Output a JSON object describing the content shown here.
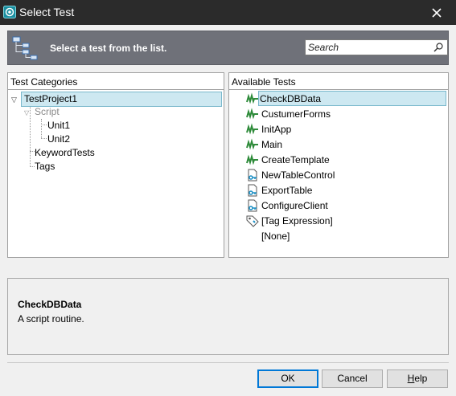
{
  "window": {
    "title": "Select Test",
    "close_icon": "close-icon",
    "app_icon": "app-icon"
  },
  "header": {
    "text": "Select a test from the list.",
    "icon": "tree-icon"
  },
  "search": {
    "placeholder": "Search",
    "icon": "search-icon"
  },
  "categories": {
    "heading": "Test Categories",
    "tree": {
      "project": "TestProject1",
      "script": "Script",
      "unit1": "Unit1",
      "unit2": "Unit2",
      "keyword_tests": "KeywordTests",
      "tags": "Tags"
    }
  },
  "tests": {
    "heading": "Available Tests",
    "items": [
      {
        "label": "CheckDBData",
        "icon": "script-routine-icon",
        "selected": true
      },
      {
        "label": "CustumerForms",
        "icon": "script-routine-icon"
      },
      {
        "label": "InitApp",
        "icon": "script-routine-icon"
      },
      {
        "label": "Main",
        "icon": "script-routine-icon"
      },
      {
        "label": "CreateTemplate",
        "icon": "script-routine-icon"
      },
      {
        "label": "NewTableControl",
        "icon": "keyword-test-icon"
      },
      {
        "label": "ExportTable",
        "icon": "keyword-test-icon"
      },
      {
        "label": "ConfigureClient",
        "icon": "keyword-test-icon"
      },
      {
        "label": "[Tag Expression]",
        "icon": "tag-icon"
      },
      {
        "label": "[None]",
        "icon": ""
      }
    ]
  },
  "description": {
    "name": "CheckDBData",
    "text": "A script routine."
  },
  "buttons": {
    "ok": "OK",
    "cancel": "Cancel",
    "help_first": "H",
    "help_rest": "elp"
  },
  "colors": {
    "titlebar": "#2b2b2b",
    "header": "#6f7179",
    "selection": "#cde8f1",
    "selection_border": "#7ab8cc",
    "default_button": "#0078d7"
  }
}
